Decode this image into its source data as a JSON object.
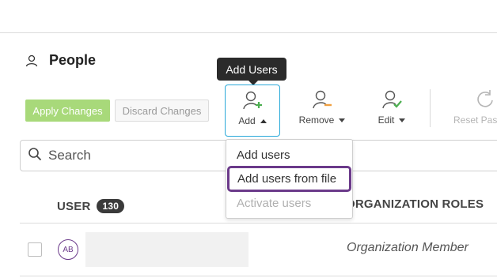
{
  "page": {
    "title": "People",
    "icon": "user-icon"
  },
  "tooltip": {
    "text": "Add Users"
  },
  "actions": {
    "apply_label": "Apply Changes",
    "discard_label": "Discard Changes"
  },
  "toolbar": {
    "add": {
      "label": "Add",
      "icon": "add-user-icon"
    },
    "remove": {
      "label": "Remove",
      "icon": "remove-user-icon"
    },
    "edit": {
      "label": "Edit",
      "icon": "edit-user-icon"
    },
    "reset": {
      "label": "Reset Pas",
      "icon": "reset-icon"
    }
  },
  "search": {
    "placeholder": "Search",
    "icon": "search-icon"
  },
  "add_menu": {
    "items": [
      "Add users",
      "Add users from file",
      "Activate users"
    ]
  },
  "table": {
    "columns": {
      "user": "USER",
      "user_count": "130",
      "org_roles": "ORGANIZATION ROLES"
    },
    "rows": [
      {
        "initials": "AB",
        "org_role": "Organization Member"
      }
    ]
  },
  "colors": {
    "accent_purple": "#6b3a8a",
    "apply_green": "#a8d97a",
    "add_blue": "#29a9d9",
    "remove_orange": "#f0a040",
    "edit_green": "#4caf50"
  }
}
